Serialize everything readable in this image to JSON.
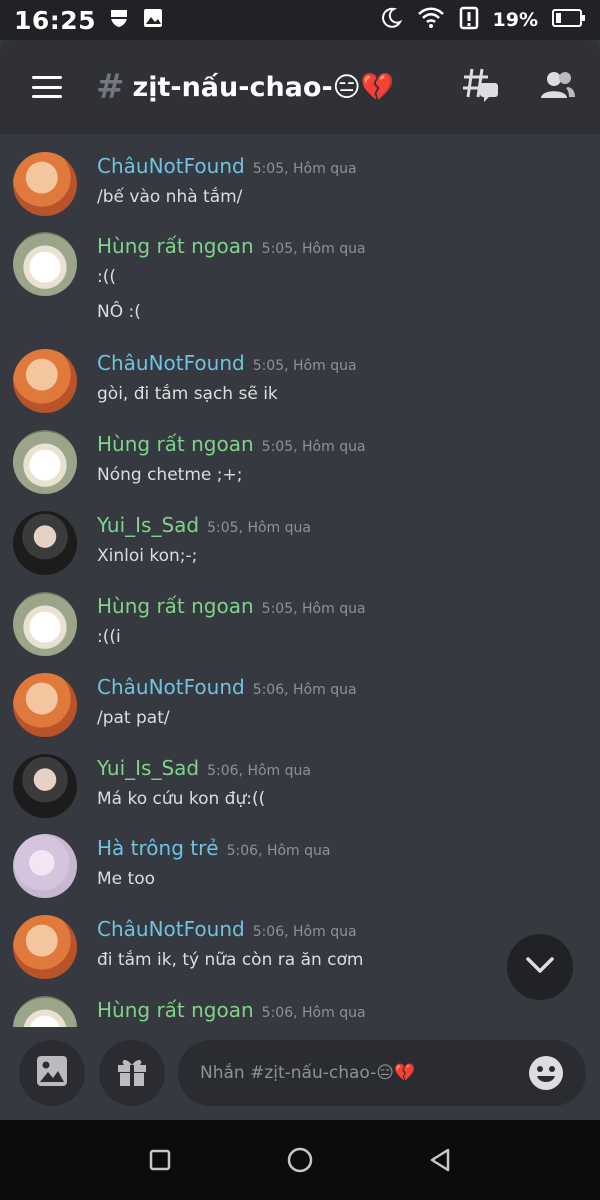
{
  "status_bar": {
    "time": "16:25",
    "battery": "19%",
    "icons": [
      "shield-icon",
      "image-icon",
      "moon-icon",
      "wifi-icon",
      "alert-icon",
      "battery-icon"
    ]
  },
  "header": {
    "hash": "#",
    "channel_name": "zịt-nấu-chao-😑💔",
    "icons": [
      "menu-icon",
      "threads-icon",
      "members-icon"
    ]
  },
  "messages": [
    {
      "author": "ChâuNotFound",
      "time": "5:05, Hôm qua",
      "lines": [
        "/bế vào nhà tắm/"
      ],
      "color": "#6fc3e0"
    },
    {
      "author": "Hùng rất ngoan",
      "time": "5:05, Hôm qua",
      "lines": [
        ":((",
        "NÔ :("
      ],
      "color": "#7fd38a"
    },
    {
      "author": "ChâuNotFound",
      "time": "5:05, Hôm qua",
      "lines": [
        "gòi, đi tắm sạch sẽ ik"
      ],
      "color": "#6fc3e0"
    },
    {
      "author": "Hùng rất ngoan",
      "time": "5:05, Hôm qua",
      "lines": [
        "Nóng chetme ;+;"
      ],
      "color": "#7fd38a"
    },
    {
      "author": "Yui_Is_Sad",
      "time": "5:05, Hôm qua",
      "lines": [
        "Xinloi kon;-;"
      ],
      "color": "#7fd38a"
    },
    {
      "author": "Hùng rất ngoan",
      "time": "5:05, Hôm qua",
      "lines": [
        ":((i"
      ],
      "color": "#7fd38a"
    },
    {
      "author": "ChâuNotFound",
      "time": "5:06, Hôm qua",
      "lines": [
        "/pat pat/"
      ],
      "color": "#6fc3e0"
    },
    {
      "author": "Yui_Is_Sad",
      "time": "5:06, Hôm qua",
      "lines": [
        "Má ko cứu kon đự:(("
      ],
      "color": "#7fd38a"
    },
    {
      "author": "Hà trông trẻ",
      "time": "5:06, Hôm qua",
      "lines": [
        "Me too"
      ],
      "color": "#6fc3e0"
    },
    {
      "author": "ChâuNotFound",
      "time": "5:06, Hôm qua",
      "lines": [
        "đi tắm ik, tý nữa còn ra ăn cơm"
      ],
      "color": "#6fc3e0"
    },
    {
      "author": "Hùng rất ngoan",
      "time": "5:06, Hôm qua",
      "lines": [],
      "color": "#7fd38a"
    }
  ],
  "composer": {
    "placeholder": "Nhắn #zịt-nấu-chao-😑💔",
    "icons": [
      "image-upload-icon",
      "gift-icon",
      "emoji-icon"
    ]
  },
  "navbar": {
    "icons": [
      "recents-icon",
      "home-icon",
      "back-icon"
    ]
  }
}
